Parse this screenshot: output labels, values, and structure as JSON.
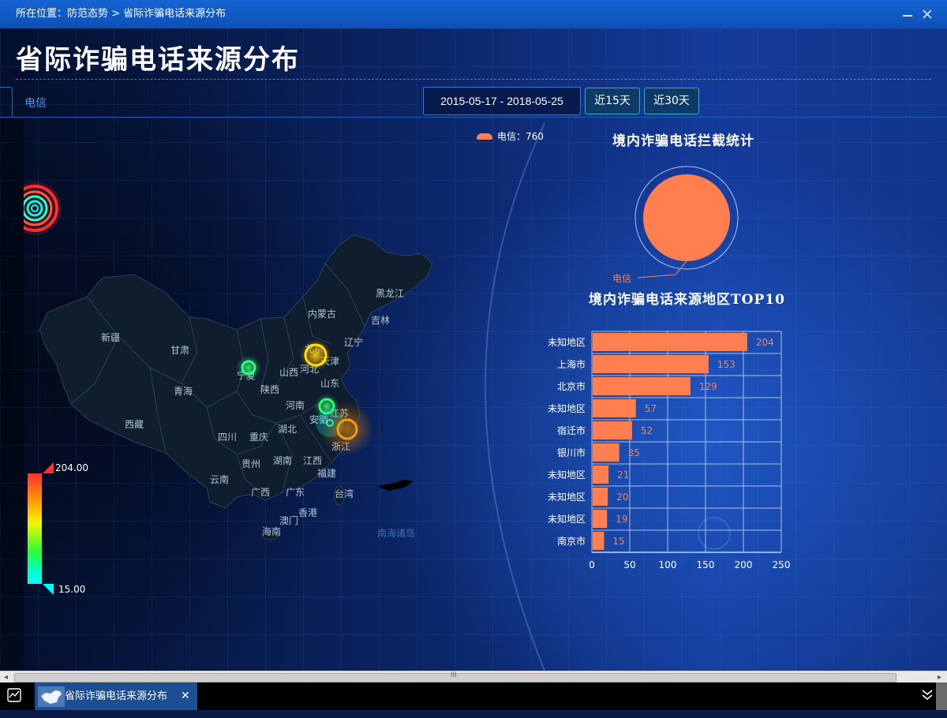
{
  "breadcrumb": "所在位置：防范态势 > 省际诈骗电话来源分布",
  "window": {
    "minimize_icon": "minimize-icon",
    "close_icon": "close-icon"
  },
  "page_title": "省际诈骗电话来源分布",
  "tab_carrier": "电信",
  "date_range": "2015-05-17 - 2018-05-25",
  "quick_buttons": {
    "last15": "近15天",
    "last30": "近30天"
  },
  "map_legend": {
    "label": "电信：760",
    "color": "#ff7f50"
  },
  "map": {
    "provinces": [
      "黑龙江",
      "吉林",
      "辽宁",
      "内蒙古",
      "北京",
      "天津",
      "河北",
      "山西",
      "山东",
      "宁夏",
      "甘肃",
      "新疆",
      "青海",
      "陕西",
      "河南",
      "江苏",
      "安徽",
      "湖北",
      "四川",
      "重庆",
      "西藏",
      "贵州",
      "湖南",
      "江西",
      "浙江",
      "福建",
      "云南",
      "广西",
      "广东",
      "香港",
      "澳门",
      "台湾",
      "海南",
      "南海诸岛"
    ],
    "visual_map": {
      "max": "204.00",
      "min": "15.00"
    }
  },
  "pie_title": "境内诈骗电话拦截统计",
  "pie_label": "电信",
  "bar_title": "境内诈骗电话来源地区TOP10",
  "chart_data": [
    {
      "type": "pie",
      "title": "境内诈骗电话拦截统计",
      "slices": [
        {
          "name": "电信",
          "value": 760,
          "color": "#ff7f50"
        }
      ]
    },
    {
      "type": "bar",
      "orientation": "horizontal",
      "title": "境内诈骗电话来源地区TOP10",
      "categories": [
        "未知地区",
        "上海市",
        "北京市",
        "未知地区",
        "宿迁市",
        "银川市",
        "未知地区",
        "未知地区",
        "未知地区",
        "南京市"
      ],
      "values": [
        204,
        153,
        129,
        57,
        52,
        35,
        21,
        20,
        19,
        15
      ],
      "xlim": [
        0,
        250
      ],
      "xticks": [
        "0",
        "50",
        "100",
        "150",
        "200",
        "250"
      ],
      "color": "#ff7f50",
      "grid": true
    }
  ],
  "scrollbar": {
    "left_arrow": "◂",
    "right_arrow": "▸",
    "grip": "III"
  },
  "taskbar": {
    "item_label": "省际诈骗电话来源分布",
    "close_glyph": "✕",
    "expand_glyph": "⌄"
  }
}
